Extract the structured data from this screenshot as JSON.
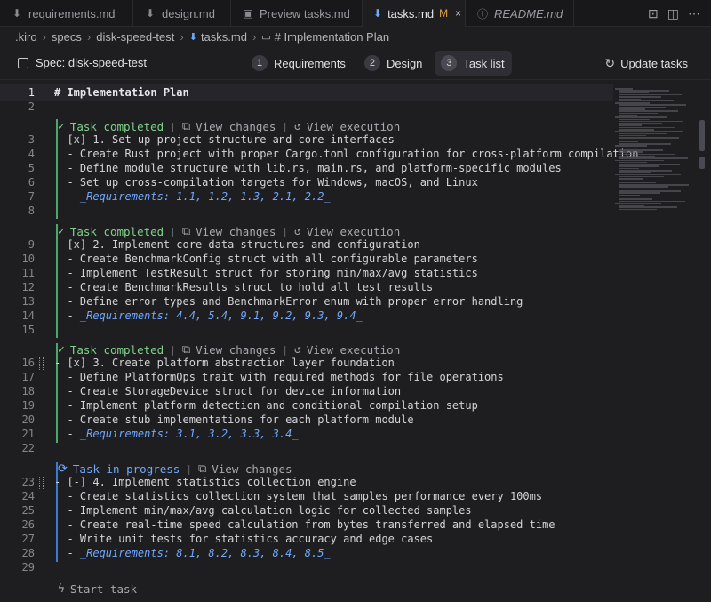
{
  "tabs": [
    {
      "label": "requirements.md",
      "icon": "markdown-icon",
      "active": false
    },
    {
      "label": "design.md",
      "icon": "markdown-icon",
      "active": false
    },
    {
      "label": "Preview tasks.md",
      "icon": "preview-icon",
      "active": false
    },
    {
      "label": "tasks.md",
      "icon": "markdown-icon",
      "active": true,
      "modified": "M",
      "close": "×"
    },
    {
      "label": "README.md",
      "icon": "info-icon",
      "active": false,
      "italic": true
    }
  ],
  "breadcrumb": [
    ".kiro",
    "specs",
    "disk-speed-test",
    "tasks.md",
    "# Implementation Plan"
  ],
  "spec": {
    "title": "Spec: disk-speed-test",
    "steps": [
      {
        "num": "1",
        "label": "Requirements"
      },
      {
        "num": "2",
        "label": "Design"
      },
      {
        "num": "3",
        "label": "Task list",
        "active": true
      }
    ],
    "update_label": "Update tasks"
  },
  "lens_text": {
    "completed": "Task completed",
    "in_progress": "Task in progress",
    "view_changes": "View changes",
    "view_execution": "View execution",
    "start_task": "Start task"
  },
  "lines": [
    {
      "n": "1",
      "text": "# Implementation Plan"
    },
    {
      "n": "2",
      "text": ""
    },
    {
      "n": "3",
      "text": "- [x] 1. Set up project structure and core interfaces"
    },
    {
      "n": "4",
      "text": "  - Create Rust project with proper Cargo.toml configuration for cross-platform compilation"
    },
    {
      "n": "5",
      "text": "  - Define module structure with lib.rs, main.rs, and platform-specific modules"
    },
    {
      "n": "6",
      "text": "  - Set up cross-compilation targets for Windows, macOS, and Linux"
    },
    {
      "n": "7",
      "text": "  - ",
      "req": "_Requirements: 1.1, 1.2, 1.3, 2.1, 2.2_"
    },
    {
      "n": "8",
      "text": ""
    },
    {
      "n": "9",
      "text": "- [x] 2. Implement core data structures and configuration"
    },
    {
      "n": "10",
      "text": "  - Create BenchmarkConfig struct with all configurable parameters"
    },
    {
      "n": "11",
      "text": "  - Implement TestResult struct for storing min/max/avg statistics"
    },
    {
      "n": "12",
      "text": "  - Create BenchmarkResults struct to hold all test results"
    },
    {
      "n": "13",
      "text": "  - Define error types and BenchmarkError enum with proper error handling"
    },
    {
      "n": "14",
      "text": "  - ",
      "req": "_Requirements: 4.4, 5.4, 9.1, 9.2, 9.3, 9.4_"
    },
    {
      "n": "15",
      "text": ""
    },
    {
      "n": "16",
      "text": "- [x] 3. Create platform abstraction layer foundation"
    },
    {
      "n": "17",
      "text": "  - Define PlatformOps trait with required methods for file operations"
    },
    {
      "n": "18",
      "text": "  - Create StorageDevice struct for device information"
    },
    {
      "n": "19",
      "text": "  - Implement platform detection and conditional compilation setup"
    },
    {
      "n": "20",
      "text": "  - Create stub implementations for each platform module"
    },
    {
      "n": "21",
      "text": "  - ",
      "req": "_Requirements: 3.1, 3.2, 3.3, 3.4_"
    },
    {
      "n": "22",
      "text": ""
    },
    {
      "n": "23",
      "text": "- [-] 4. Implement statistics collection engine"
    },
    {
      "n": "24",
      "text": "  - Create statistics collection system that samples performance every 100ms"
    },
    {
      "n": "25",
      "text": "  - Implement min/max/avg calculation logic for collected samples"
    },
    {
      "n": "26",
      "text": "  - Create real-time speed calculation from bytes transferred and elapsed time"
    },
    {
      "n": "27",
      "text": "  - Write unit tests for statistics accuracy and edge cases"
    },
    {
      "n": "28",
      "text": "  - ",
      "req": "_Requirements: 8.1, 8.2, 8.3, 8.4, 8.5_"
    },
    {
      "n": "29",
      "text": ""
    }
  ]
}
